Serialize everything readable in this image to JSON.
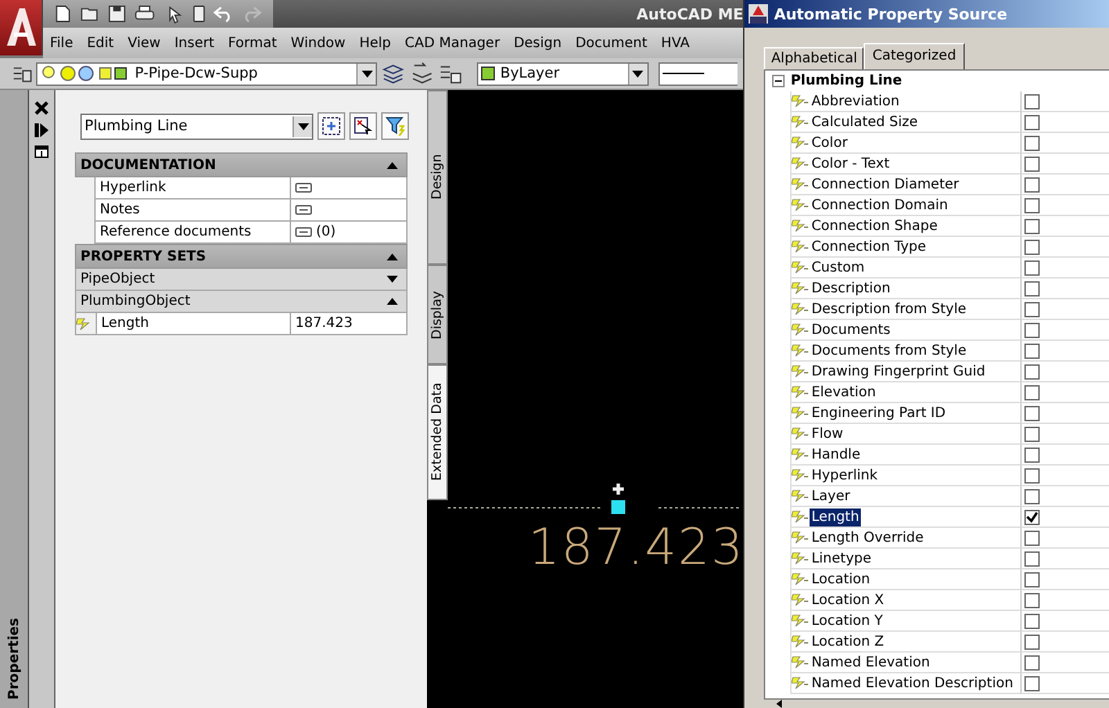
{
  "app_title": "AutoCAD ME",
  "menu": [
    "File",
    "Edit",
    "View",
    "Insert",
    "Format",
    "Window",
    "Help",
    "CAD Manager",
    "Design",
    "Document",
    "HVA"
  ],
  "layer_combo": {
    "value": "P-Pipe-Dcw-Supp"
  },
  "color_combo": {
    "value": "ByLayer"
  },
  "palette": {
    "title": "Properties",
    "object_type": "Plumbing Line",
    "documentation": {
      "title": "DOCUMENTATION",
      "expanded": true,
      "rows": [
        {
          "label": "Hyperlink"
        },
        {
          "label": "Notes"
        },
        {
          "label": "Reference documents",
          "value": "(0)"
        }
      ]
    },
    "property_sets": {
      "title": "PROPERTY SETS",
      "expanded": true,
      "sets": [
        {
          "name": "PipeObject",
          "expanded": false
        },
        {
          "name": "PlumbingObject",
          "expanded": true,
          "rows": [
            {
              "label": "Length",
              "value": "187.423"
            }
          ]
        }
      ]
    },
    "side_tabs": [
      {
        "label": "Design",
        "selected": false
      },
      {
        "label": "Display",
        "selected": false
      },
      {
        "label": "Extended Data",
        "selected": true
      }
    ]
  },
  "canvas": {
    "dimension_text": "187.423"
  },
  "dialog": {
    "title": "Automatic Property Source",
    "tabs": [
      {
        "label": "Alphabetical",
        "selected": false
      },
      {
        "label": "Categorized",
        "selected": true
      }
    ],
    "category": {
      "name": "Plumbing Line",
      "expanded": true,
      "properties": [
        {
          "label": "Abbreviation",
          "checked": false,
          "selected": false
        },
        {
          "label": "Calculated Size",
          "checked": false,
          "selected": false
        },
        {
          "label": "Color",
          "checked": false,
          "selected": false
        },
        {
          "label": "Color - Text",
          "checked": false,
          "selected": false
        },
        {
          "label": "Connection Diameter",
          "checked": false,
          "selected": false
        },
        {
          "label": "Connection Domain",
          "checked": false,
          "selected": false
        },
        {
          "label": "Connection Shape",
          "checked": false,
          "selected": false
        },
        {
          "label": "Connection Type",
          "checked": false,
          "selected": false
        },
        {
          "label": "Custom",
          "checked": false,
          "selected": false
        },
        {
          "label": "Description",
          "checked": false,
          "selected": false
        },
        {
          "label": "Description from Style",
          "checked": false,
          "selected": false
        },
        {
          "label": "Documents",
          "checked": false,
          "selected": false
        },
        {
          "label": "Documents from Style",
          "checked": false,
          "selected": false
        },
        {
          "label": "Drawing Fingerprint Guid",
          "checked": false,
          "selected": false
        },
        {
          "label": "Elevation",
          "checked": false,
          "selected": false
        },
        {
          "label": "Engineering Part ID",
          "checked": false,
          "selected": false
        },
        {
          "label": "Flow",
          "checked": false,
          "selected": false
        },
        {
          "label": "Handle",
          "checked": false,
          "selected": false
        },
        {
          "label": "Hyperlink",
          "checked": false,
          "selected": false
        },
        {
          "label": "Layer",
          "checked": false,
          "selected": false
        },
        {
          "label": "Length",
          "checked": true,
          "selected": true
        },
        {
          "label": "Length Override",
          "checked": false,
          "selected": false
        },
        {
          "label": "Linetype",
          "checked": false,
          "selected": false
        },
        {
          "label": "Location",
          "checked": false,
          "selected": false
        },
        {
          "label": "Location X",
          "checked": false,
          "selected": false
        },
        {
          "label": "Location Y",
          "checked": false,
          "selected": false
        },
        {
          "label": "Location Z",
          "checked": false,
          "selected": false
        },
        {
          "label": "Named Elevation",
          "checked": false,
          "selected": false
        },
        {
          "label": "Named Elevation Description",
          "checked": false,
          "selected": false
        }
      ]
    }
  }
}
